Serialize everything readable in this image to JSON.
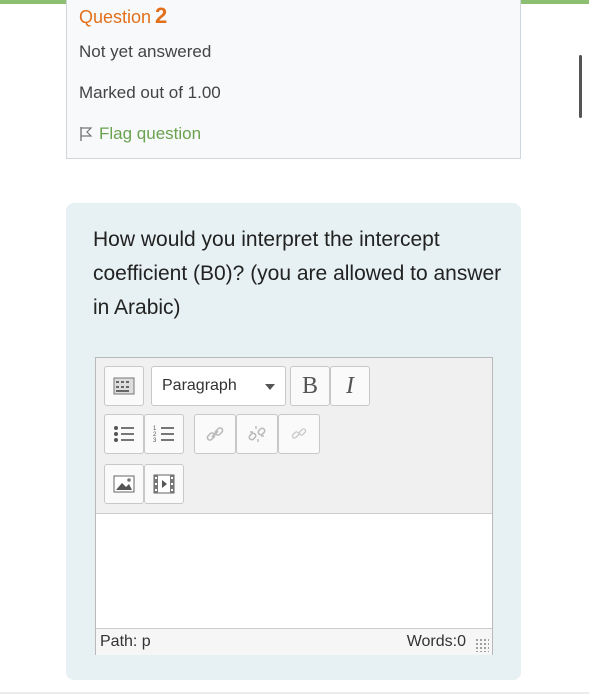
{
  "info": {
    "question_label": "Question",
    "question_number": "2",
    "status": "Not yet answered",
    "marks": "Marked out of 1.00",
    "flag_label": "Flag question"
  },
  "question": {
    "text": "How would you interpret the intercept coefficient (B0)? (you are allowed to answer in Arabic)"
  },
  "editor": {
    "format_select": "Paragraph",
    "bold_label": "B",
    "italic_label": "I",
    "icons": [
      "toolbar-toggle-icon",
      "bullet-list-icon",
      "numbered-list-icon",
      "link-icon",
      "unlink-icon",
      "emoticon-icon",
      "image-icon",
      "media-icon"
    ],
    "content": "",
    "path": "Path: p",
    "words": "Words:0"
  },
  "colors": {
    "accent_orange": "#e2701a",
    "flag_green": "#6aa24f",
    "question_bg": "#e7f1f3",
    "top_bar": "#8cbf71"
  }
}
